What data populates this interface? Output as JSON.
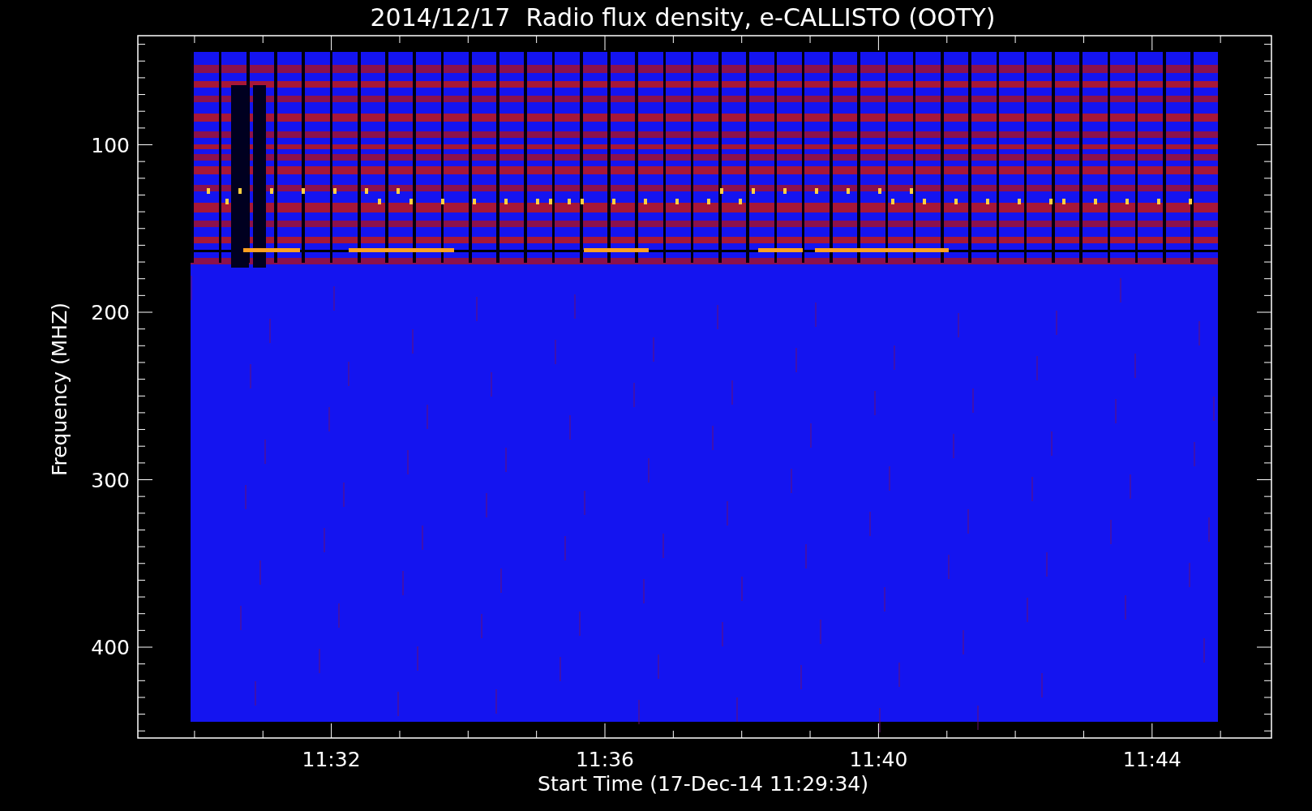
{
  "title": "2014/12/17  Radio flux density, e-CALLISTO (OOTY)",
  "plot": {
    "ylabel": "Frequency (MHZ)",
    "xlabel": "Start Time (17-Dec-14 11:29:34)",
    "yticks": [
      "100",
      "200",
      "300",
      "400"
    ],
    "xticks": [
      "11:32",
      "11:36",
      "11:40",
      "11:44"
    ]
  }
}
